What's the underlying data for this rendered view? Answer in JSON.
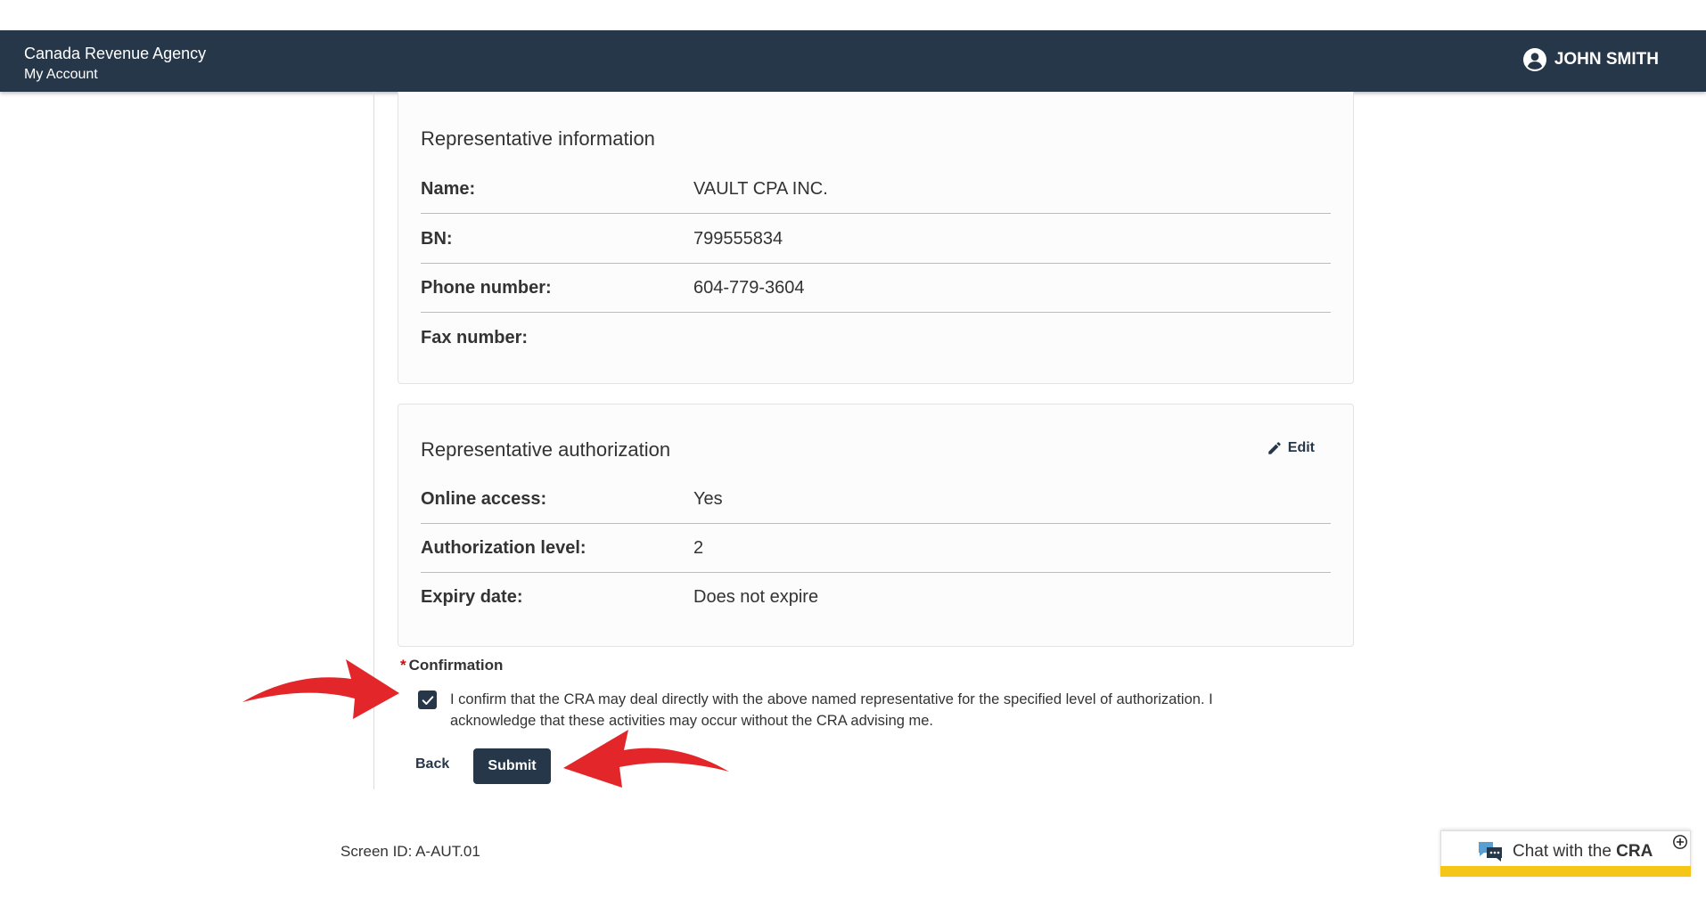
{
  "header": {
    "agency": "Canada Revenue Agency",
    "subtitle": "My Account",
    "user_name": "JOHN SMITH"
  },
  "rep_info": {
    "title": "Representative information",
    "rows": [
      {
        "label": "Name:",
        "value": "VAULT CPA INC."
      },
      {
        "label": "BN:",
        "value": "799555834"
      },
      {
        "label": "Phone number:",
        "value": "604-779-3604"
      },
      {
        "label": "Fax number:",
        "value": ""
      }
    ]
  },
  "rep_auth": {
    "title": "Representative authorization",
    "edit_label": "Edit",
    "rows": [
      {
        "label": "Online access:",
        "value": "Yes"
      },
      {
        "label": "Authorization level:",
        "value": "2"
      },
      {
        "label": "Expiry date:",
        "value": "Does not expire"
      }
    ]
  },
  "confirmation": {
    "required_mark": "*",
    "label": "Confirmation",
    "checked": true,
    "text": "I confirm that the CRA may deal directly with the above named representative for the specified level of authorization. I acknowledge that these activities may occur without the CRA advising me."
  },
  "actions": {
    "back_label": "Back",
    "submit_label": "Submit"
  },
  "footer": {
    "screen_id": "Screen ID: A-AUT.01"
  },
  "chat": {
    "label_prefix": "Chat with the ",
    "label_bold": "CRA"
  },
  "colors": {
    "header_bg": "#26374a",
    "arrow": "#e3262a",
    "chat_accent": "#f5c518"
  }
}
